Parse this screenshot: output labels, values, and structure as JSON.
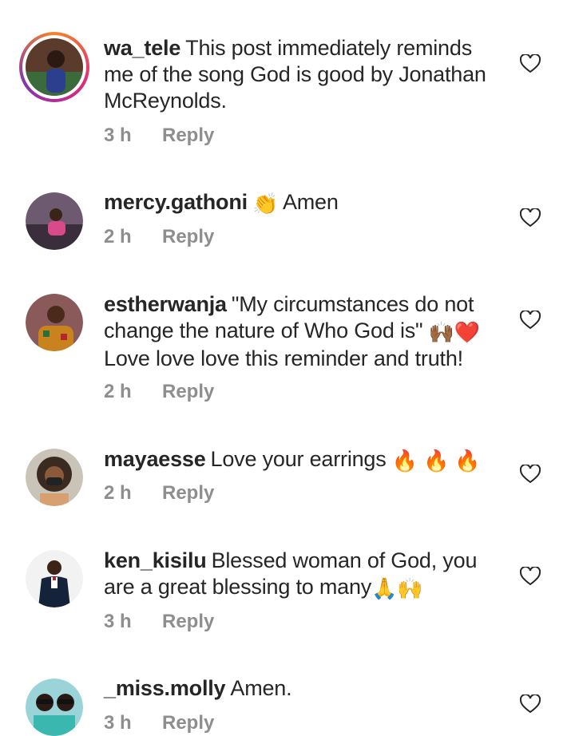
{
  "comments": [
    {
      "username": "wa_tele",
      "text": "This post immediately reminds me of the song God is good by Jonathan McReynolds.",
      "emoji": "",
      "time": "3 h",
      "reply": "Reply"
    },
    {
      "username": "mercy.gathoni",
      "text": "Amen",
      "emoji": "👏",
      "time": "2 h",
      "reply": "Reply"
    },
    {
      "username": "estherwanja",
      "text": "\"My circumstances do not change the nature of Who God is\" ",
      "emoji": "🙌🏾❤️",
      "text2": "Love love love this reminder and truth!",
      "time": "2 h",
      "reply": "Reply"
    },
    {
      "username": "mayaesse",
      "text": "Love your earrings ",
      "emoji": "🔥 🔥 🔥",
      "time": "2 h",
      "reply": "Reply"
    },
    {
      "username": "ken_kisilu",
      "text": "Blessed woman of God, you are a great blessing to many",
      "emoji": "🙏🙌",
      "time": "3 h",
      "reply": "Reply"
    },
    {
      "username": "_miss.molly",
      "text": "Amen.",
      "emoji": "",
      "time": "3 h",
      "reply": "Reply"
    }
  ],
  "icons": {
    "like": "heart-outline-icon"
  },
  "colors": {
    "text": "#262626",
    "meta": "#8e8e8e"
  }
}
